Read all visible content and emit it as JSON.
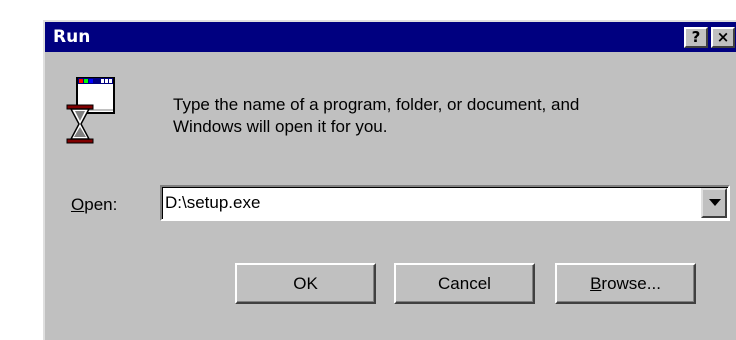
{
  "window": {
    "title": "Run",
    "help_button": "?",
    "close_button": "×"
  },
  "prompt": {
    "line1": "Type the name of a program, folder, or document, and",
    "line2": "Windows will open it for you."
  },
  "open_field": {
    "label_accel": "O",
    "label_rest": "pen:",
    "value": "D:\\setup.exe"
  },
  "buttons": {
    "ok": "OK",
    "cancel": "Cancel",
    "browse_accel": "B",
    "browse_rest": "rowse..."
  },
  "icons": {
    "run": "run-program-icon",
    "dropdown": "chevron-down-icon"
  },
  "colors": {
    "titlebar": "#000080",
    "face": "#c0c0c0"
  }
}
